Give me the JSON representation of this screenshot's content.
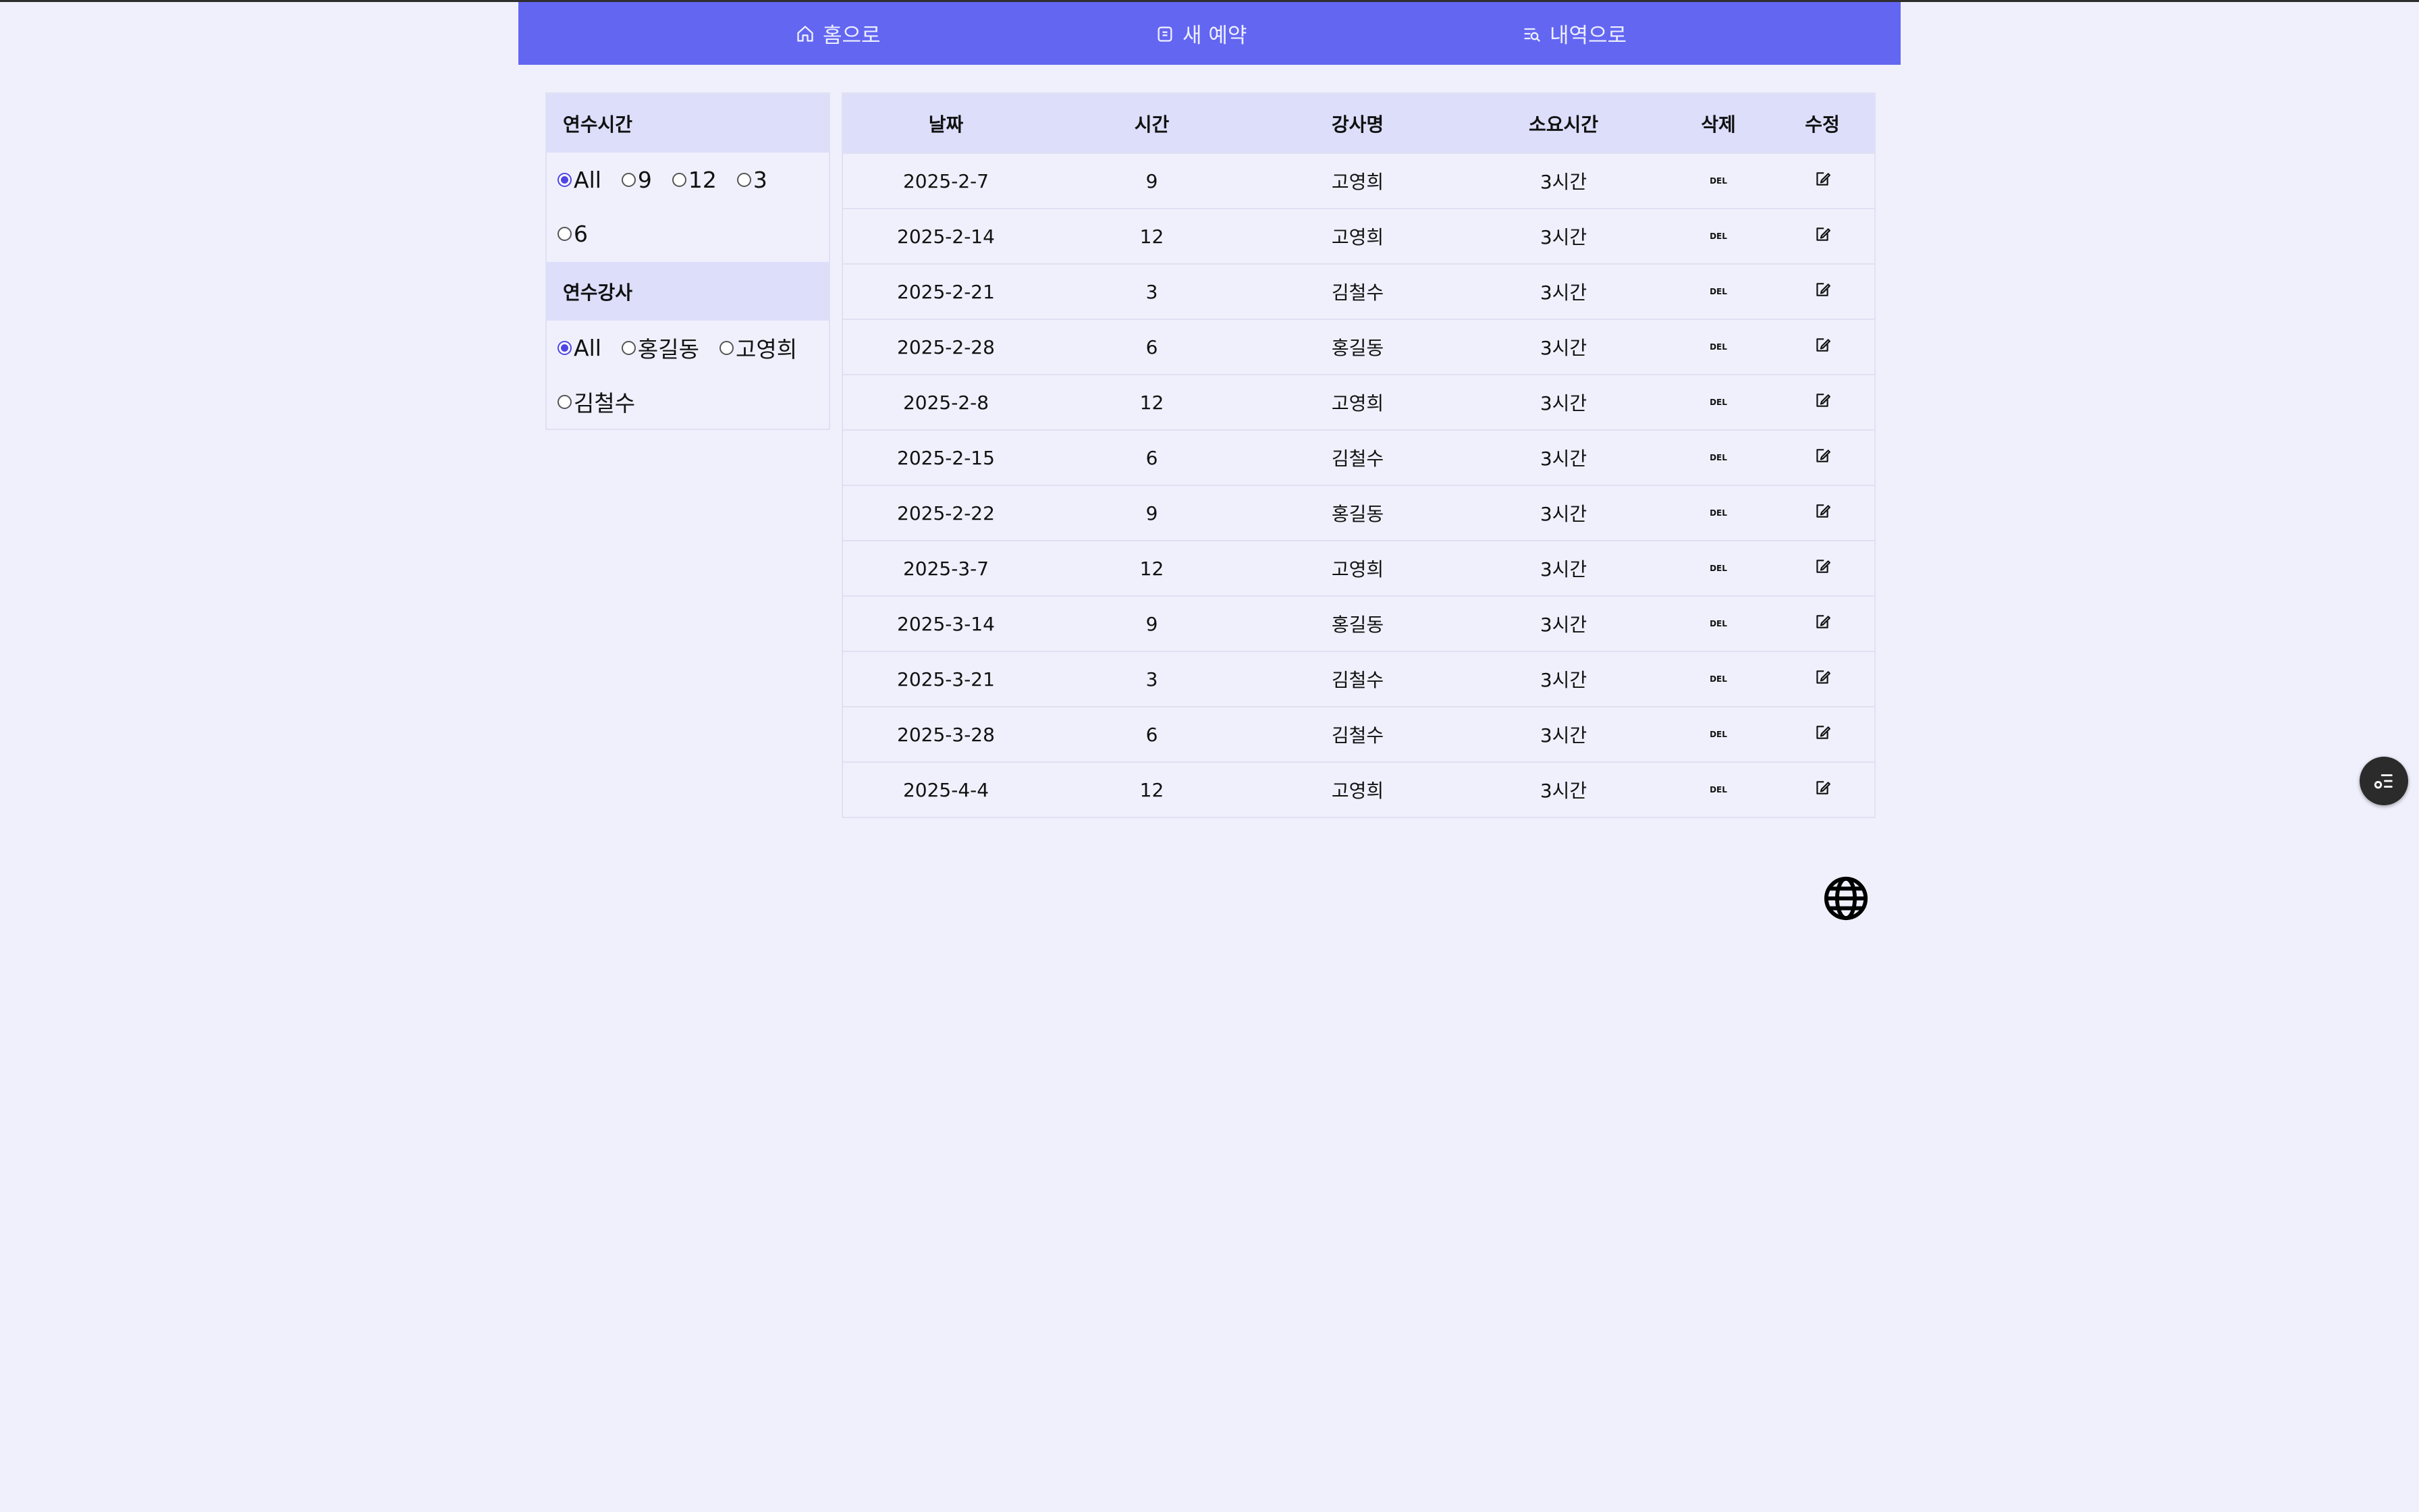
{
  "nav": {
    "home": {
      "label": "홈으로",
      "icon": "home-icon"
    },
    "reserve": {
      "label": "새 예약",
      "icon": "calendar-icon"
    },
    "history": {
      "label": "내역으로",
      "icon": "list-search-icon"
    }
  },
  "filters": {
    "hours": {
      "title": "연수시간",
      "options": [
        "All",
        "9",
        "12",
        "3",
        "6"
      ],
      "selected": "All"
    },
    "instructor": {
      "title": "연수강사",
      "options": [
        "All",
        "홍길동",
        "고영희",
        "김철수"
      ],
      "selected": "All"
    }
  },
  "table": {
    "headers": [
      "날짜",
      "시간",
      "강사명",
      "소요시간",
      "삭제",
      "수정"
    ],
    "delete_label": "DEL",
    "rows": [
      {
        "date": "2025-2-7",
        "time": "9",
        "instructor": "고영희",
        "duration": "3시간"
      },
      {
        "date": "2025-2-14",
        "time": "12",
        "instructor": "고영희",
        "duration": "3시간"
      },
      {
        "date": "2025-2-21",
        "time": "3",
        "instructor": "김철수",
        "duration": "3시간"
      },
      {
        "date": "2025-2-28",
        "time": "6",
        "instructor": "홍길동",
        "duration": "3시간"
      },
      {
        "date": "2025-2-8",
        "time": "12",
        "instructor": "고영희",
        "duration": "3시간"
      },
      {
        "date": "2025-2-15",
        "time": "6",
        "instructor": "김철수",
        "duration": "3시간"
      },
      {
        "date": "2025-2-22",
        "time": "9",
        "instructor": "홍길동",
        "duration": "3시간"
      },
      {
        "date": "2025-3-7",
        "time": "12",
        "instructor": "고영희",
        "duration": "3시간"
      },
      {
        "date": "2025-3-14",
        "time": "9",
        "instructor": "홍길동",
        "duration": "3시간"
      },
      {
        "date": "2025-3-21",
        "time": "3",
        "instructor": "김철수",
        "duration": "3시간"
      },
      {
        "date": "2025-3-28",
        "time": "6",
        "instructor": "김철수",
        "duration": "3시간"
      },
      {
        "date": "2025-4-4",
        "time": "12",
        "instructor": "고영희",
        "duration": "3시간"
      }
    ]
  },
  "icons": {
    "globe": "globe-icon",
    "fab": "settings-list-icon"
  },
  "colors": {
    "nav_bg": "#6366f1",
    "header_bg": "#dcdefa",
    "page_bg": "#f0f0fd",
    "radio_accent": "#4f46e5"
  }
}
